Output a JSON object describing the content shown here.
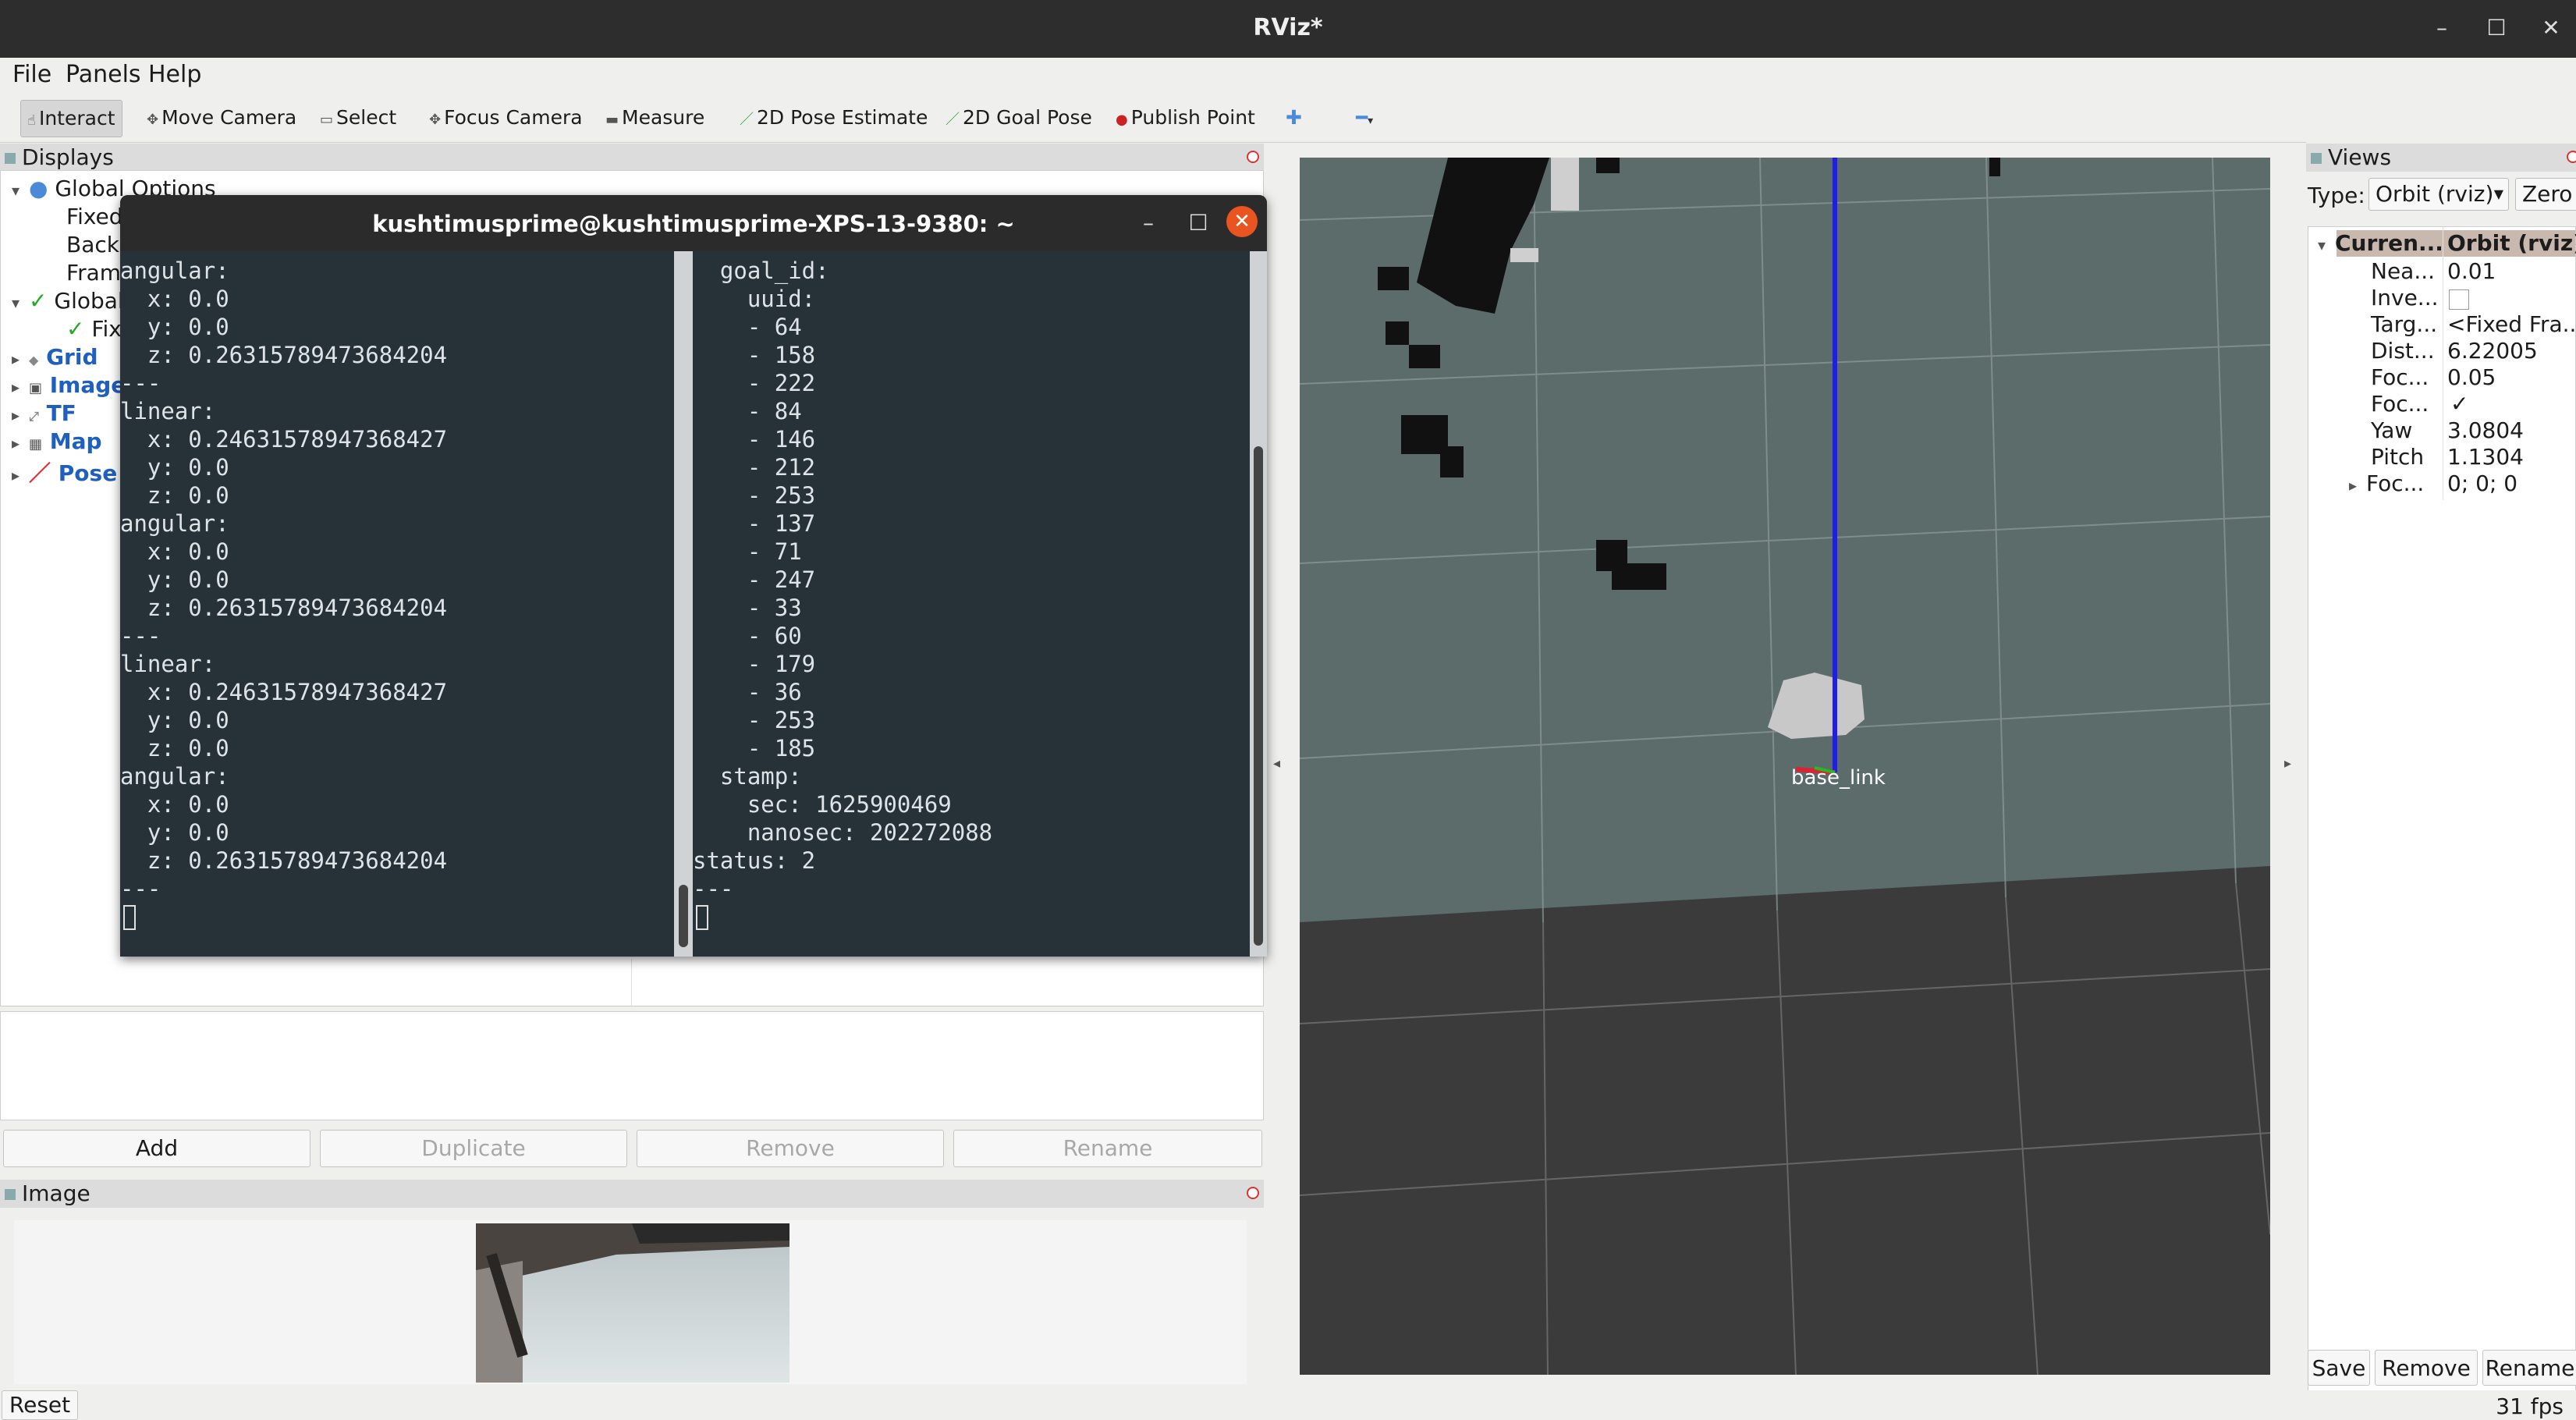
{
  "window": {
    "title": "RViz*"
  },
  "menu": [
    "File",
    "Panels",
    "Help"
  ],
  "toolbar": {
    "tools": [
      "Interact",
      "Move Camera",
      "Select",
      "Focus Camera",
      "Measure",
      "2D Pose Estimate",
      "2D Goal Pose",
      "Publish Point"
    ]
  },
  "displays": {
    "title": "Displays",
    "rows": [
      "Global Options",
      "Fixed",
      "Backg",
      "Fram",
      "Global",
      "Fixe",
      "Grid",
      "Image",
      "TF",
      "Map",
      "Pose"
    ],
    "buttons": {
      "add": "Add",
      "duplicate": "Duplicate",
      "remove": "Remove",
      "rename": "Rename"
    }
  },
  "terminal": {
    "title": "kushtimusprime@kushtimusprime-XPS-13-9380: ~",
    "left_lines": [
      "angular:",
      "  x: 0.0",
      "  y: 0.0",
      "  z: 0.26315789473684204",
      "---",
      "linear:",
      "  x: 0.24631578947368427",
      "  y: 0.0",
      "  z: 0.0",
      "angular:",
      "  x: 0.0",
      "  y: 0.0",
      "  z: 0.26315789473684204",
      "---",
      "linear:",
      "  x: 0.24631578947368427",
      "  y: 0.0",
      "  z: 0.0",
      "angular:",
      "  x: 0.0",
      "  y: 0.0",
      "  z: 0.26315789473684204",
      "---"
    ],
    "right_lines": [
      "  goal_id:",
      "    uuid:",
      "    - 64",
      "    - 158",
      "    - 222",
      "    - 84",
      "    - 146",
      "    - 212",
      "    - 253",
      "    - 137",
      "    - 71",
      "    - 247",
      "    - 33",
      "    - 60",
      "    - 179",
      "    - 36",
      "    - 253",
      "    - 185",
      "  stamp:",
      "    sec: 1625900469",
      "    nanosec: 202272088",
      "status: 2",
      "---"
    ]
  },
  "image_panel": {
    "title": "Image",
    "reset": "Reset"
  },
  "view3d": {
    "frame_label": "base_link"
  },
  "views": {
    "title": "Views",
    "type_label": "Type:",
    "type_value": "Orbit (rviz)",
    "zero_label": "Zero",
    "current_label": "Curren...",
    "current_value": "Orbit (rviz)",
    "props": [
      {
        "name": "Nea...",
        "value": "0.01"
      },
      {
        "name": "Inve...",
        "value": ""
      },
      {
        "name": "Targ...",
        "value": "<Fixed Fra..."
      },
      {
        "name": "Dist...",
        "value": "6.22005"
      },
      {
        "name": "Foc...",
        "value": "0.05"
      },
      {
        "name": "Foc...",
        "value": "✓"
      },
      {
        "name": "Yaw",
        "value": "3.0804"
      },
      {
        "name": "Pitch",
        "value": "1.1304"
      },
      {
        "name": "Foc...",
        "value": "0; 0; 0"
      }
    ],
    "buttons": {
      "save": "Save",
      "remove": "Remove",
      "rename": "Rename"
    }
  },
  "status": {
    "fps": "31 fps"
  }
}
